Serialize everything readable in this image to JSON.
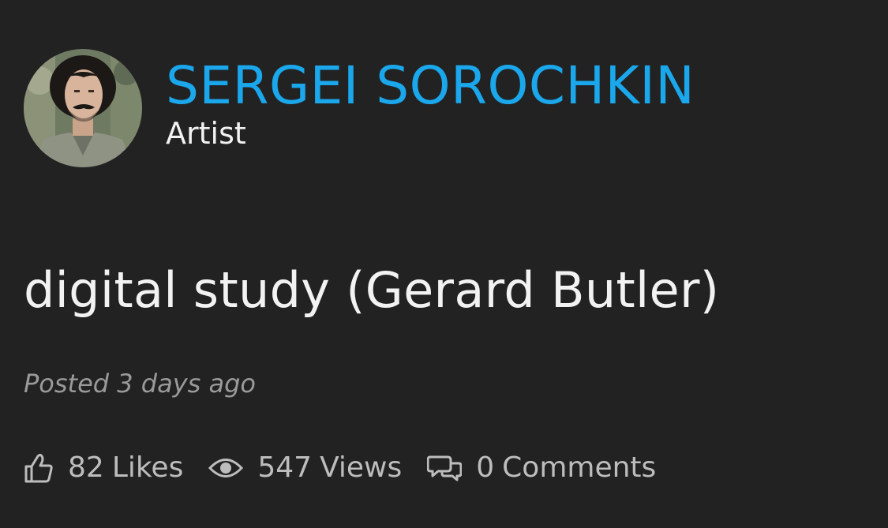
{
  "artist": {
    "name": "SERGEI SOROCHKIN",
    "role": "Artist",
    "avatar_icon": "artist-avatar-photo"
  },
  "artwork": {
    "title": "digital study (Gerard Butler)",
    "posted": "Posted 3 days ago"
  },
  "stats": {
    "likes": {
      "icon": "thumbs-up-icon",
      "count": "82",
      "label": "Likes"
    },
    "views": {
      "icon": "eye-icon",
      "count": "547",
      "label": "Views"
    },
    "comments": {
      "icon": "comments-icon",
      "count": "0",
      "label": "Comments"
    }
  },
  "colors": {
    "background": "#222222",
    "accent": "#1aa7ec",
    "text": "#f2f2f2",
    "muted": "#9a9a9a",
    "stat_text": "#bdbdbd"
  }
}
